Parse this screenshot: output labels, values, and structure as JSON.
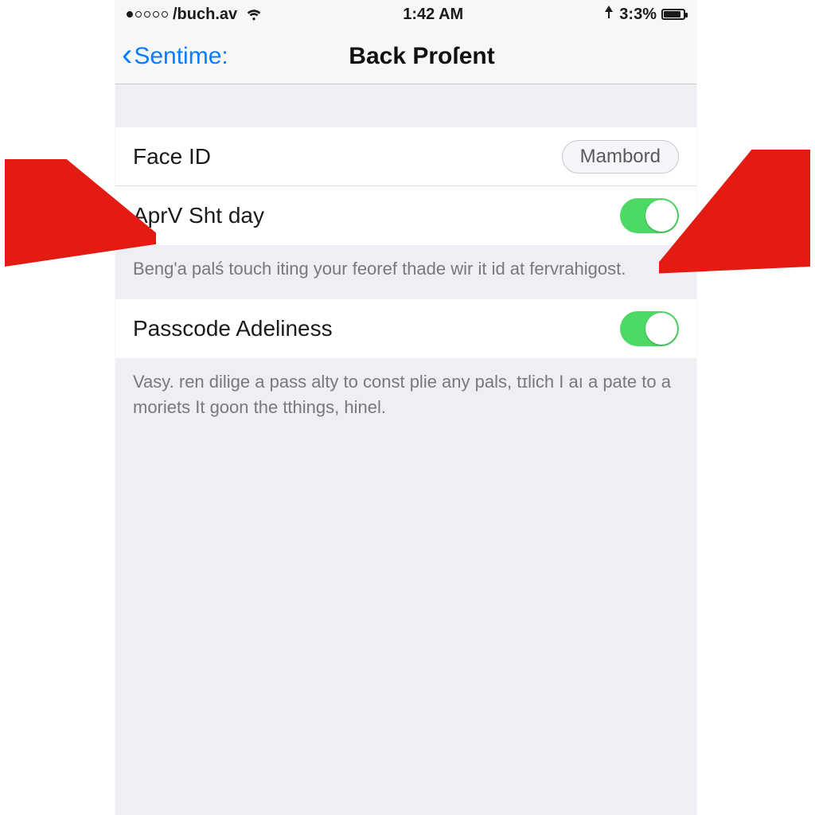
{
  "status_bar": {
    "carrier": "/buch.av",
    "time": "1:42 AM",
    "battery_text": "3:3%"
  },
  "nav": {
    "back_label": "Sentime:",
    "title": "Back Proſent"
  },
  "rows": {
    "face_id": {
      "label": "Face ID",
      "button": "Mambord"
    },
    "aprv": {
      "label": "AprV Sht day"
    },
    "passcode": {
      "label": "Passcode Adeliness"
    }
  },
  "footers": {
    "aprv": "Beng'a palś touch iting your feoref thade wir it id at fervrahigost.",
    "passcode": "Vasy. ren dilige a pass alty to const plie any pals, tɪlich I aı a pate to a moriets It goon the tthings, hinel."
  },
  "colors": {
    "accent_blue": "#0a7cff",
    "toggle_green": "#4cd964",
    "arrow_red": "#e31b12"
  }
}
